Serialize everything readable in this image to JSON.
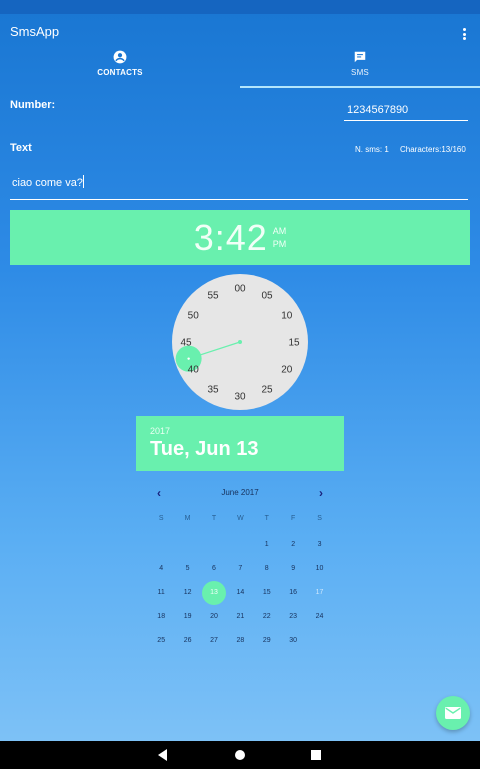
{
  "app": {
    "title": "SmsApp"
  },
  "tabs": [
    {
      "label": "CONTACTS",
      "icon": "account-circle-icon",
      "selected": false
    },
    {
      "label": "SMS",
      "icon": "message-icon",
      "selected": true
    }
  ],
  "form": {
    "number_label": "Number:",
    "number_value": "1234567890",
    "text_label": "Text",
    "sms_count": "N. sms: 1",
    "char_count": "Characters:13/160",
    "text_value": "ciao come va?"
  },
  "time_picker": {
    "hour": "3",
    "separator": ":",
    "minute": "42",
    "am": "AM",
    "pm": "PM",
    "dial_labels": [
      "00",
      "05",
      "10",
      "15",
      "20",
      "25",
      "30",
      "35",
      "40",
      "45",
      "50",
      "55"
    ],
    "selected_minute": 42
  },
  "date_picker": {
    "year": "2017",
    "date": "Tue, Jun 13",
    "month": "June 2017",
    "weekdays": [
      "S",
      "M",
      "T",
      "W",
      "T",
      "F",
      "S"
    ],
    "weeks": [
      [
        "",
        "",
        "",
        "",
        "1",
        "2",
        "3"
      ],
      [
        "4",
        "5",
        "6",
        "7",
        "8",
        "9",
        "10"
      ],
      [
        "11",
        "12",
        "13",
        "14",
        "15",
        "16",
        "17"
      ],
      [
        "18",
        "19",
        "20",
        "21",
        "22",
        "23",
        "24"
      ],
      [
        "25",
        "26",
        "27",
        "28",
        "29",
        "30",
        ""
      ]
    ],
    "selected_day": "13",
    "faded_day": "17"
  },
  "colors": {
    "accent": "#69f0ae",
    "primary": "#1976d2",
    "status_bar": "#1565c0"
  },
  "fab": {
    "icon": "email-icon"
  }
}
